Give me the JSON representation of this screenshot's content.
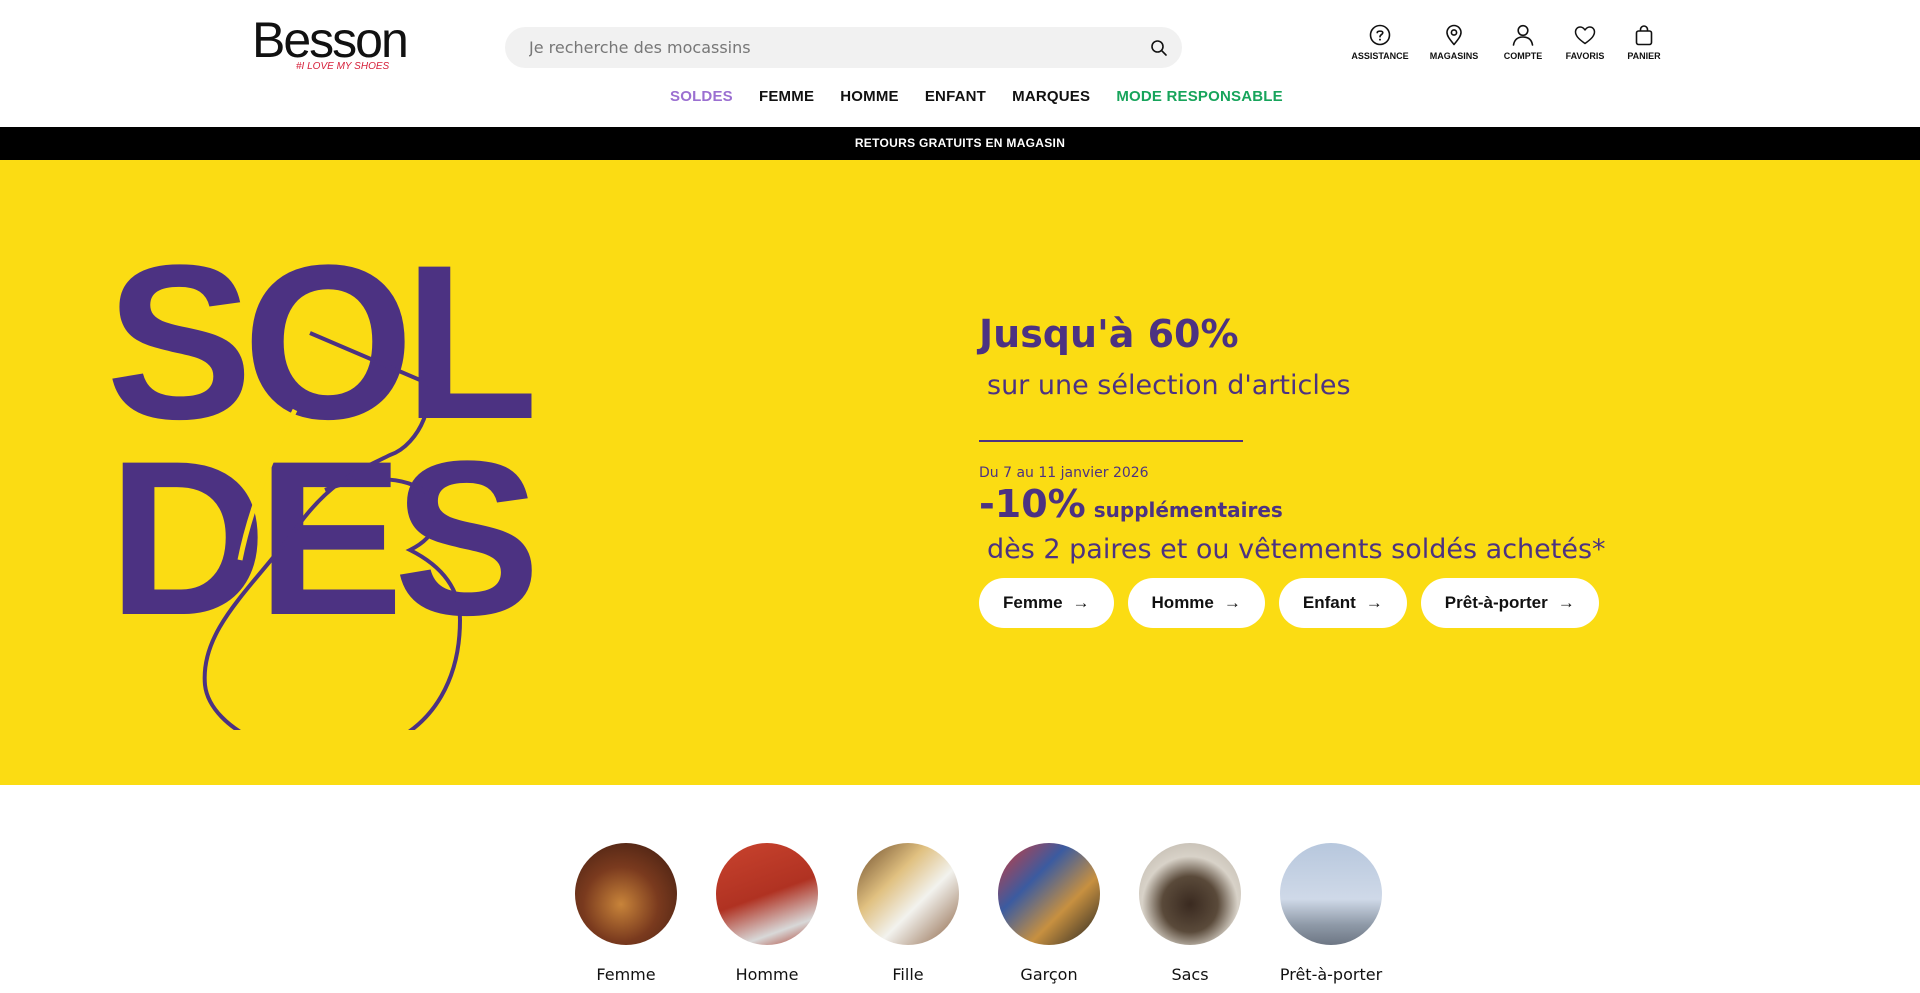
{
  "brand": {
    "name": "Besson",
    "tagline": "#I LOVE MY SHOES"
  },
  "search": {
    "placeholder": "Je recherche des mocassins",
    "value": ""
  },
  "header_icons": [
    {
      "label": "ASSISTANCE",
      "icon": "help-circle-icon"
    },
    {
      "label": "MAGASINS",
      "icon": "map-pin-icon"
    },
    {
      "label": "COMPTE",
      "icon": "user-icon"
    },
    {
      "label": "FAVORIS",
      "icon": "heart-icon"
    },
    {
      "label": "PANIER",
      "icon": "shopping-bag-icon"
    }
  ],
  "nav": [
    {
      "label": "SOLDES",
      "color": "#9b6fd1"
    },
    {
      "label": "FEMME",
      "color": "#111111"
    },
    {
      "label": "HOMME",
      "color": "#111111"
    },
    {
      "label": "ENFANT",
      "color": "#111111"
    },
    {
      "label": "MARQUES",
      "color": "#111111"
    },
    {
      "label": "MODE RESPONSABLE",
      "color": "#17a45b"
    }
  ],
  "promo_bar": {
    "text": "RETOURS GRATUITS EN MAGASIN"
  },
  "hero": {
    "art_text_line1": "SOL",
    "art_text_line2": "DES",
    "headline": "Jusqu'à 60%",
    "subline": " sur une sélection d'articles",
    "dates": "Du 7 au 11 janvier 2026",
    "extra_big": "-10%",
    "extra_small": "supplémentaires",
    "condition": " dès 2 paires et ou vêtements soldés achetés*",
    "buttons": [
      {
        "label": "Femme"
      },
      {
        "label": "Homme"
      },
      {
        "label": "Enfant"
      },
      {
        "label": "Prêt-à-porter"
      }
    ],
    "colors": {
      "background": "#fbdc13",
      "accent": "#4c3282"
    }
  },
  "categories": [
    {
      "label": "Femme"
    },
    {
      "label": "Homme"
    },
    {
      "label": "Fille"
    },
    {
      "label": "Garçon"
    },
    {
      "label": "Sacs"
    },
    {
      "label": "Prêt-à-porter"
    }
  ]
}
